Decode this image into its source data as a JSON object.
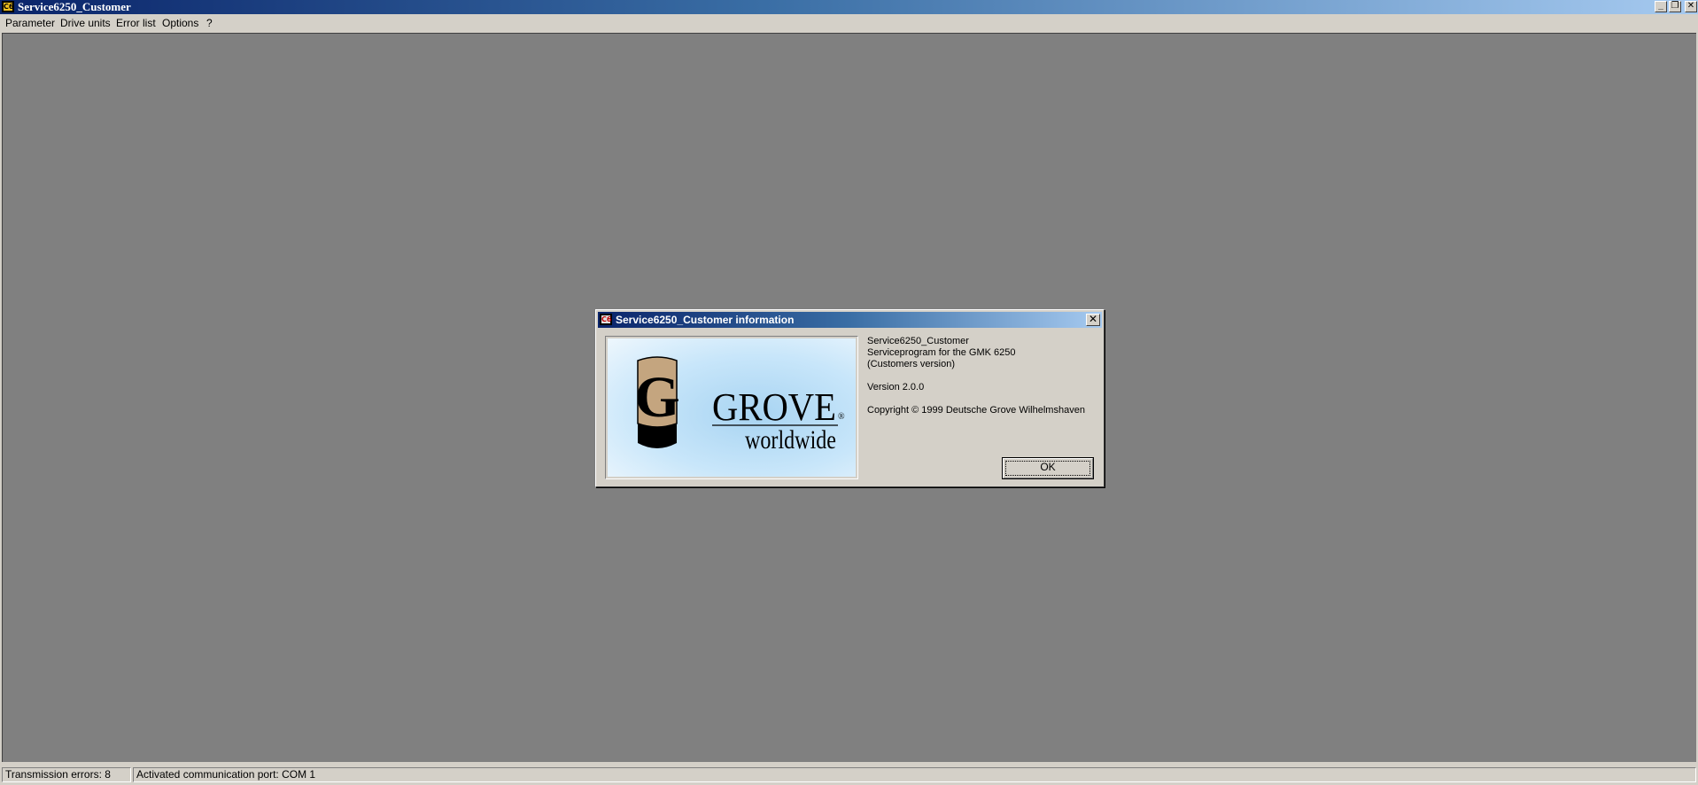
{
  "window": {
    "title": "Service6250_Customer",
    "icon": "app-icon",
    "icon_glyph": "C6"
  },
  "menu": {
    "items": [
      {
        "label": "Parameter"
      },
      {
        "label": "Drive units"
      },
      {
        "label": "Error list"
      },
      {
        "label": "Options"
      },
      {
        "label": "?"
      }
    ]
  },
  "dialog": {
    "title": "Service6250_Customer information",
    "logo": {
      "letter": "G",
      "brand": "GROVE",
      "tagline": "worldwide",
      "registered": "®"
    },
    "info_lines": [
      "Service6250_Customer",
      "Serviceprogram for the GMK 6250",
      "(Customers version)"
    ],
    "version": "Version 2.0.0",
    "copyright": "Copyright © 1999 Deutsche Grove Wilhelmshaven",
    "ok_label": "OK"
  },
  "status": {
    "errors": "Transmission errors: 8",
    "port": "Activated communication port: COM 1"
  },
  "colors": {
    "titlebar_start": "#0a246a",
    "titlebar_end": "#a6caf0",
    "workspace": "#808080",
    "face": "#d4d0c8",
    "logo_tan": "#c4a57f"
  }
}
